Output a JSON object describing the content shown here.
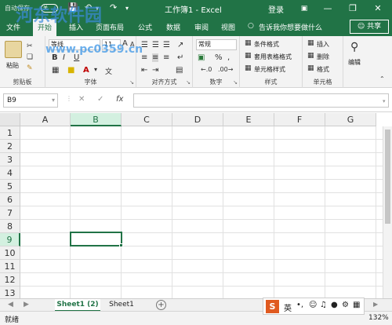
{
  "window": {
    "autosave_label": "自动保存",
    "autosave_state": "关",
    "title": "工作簿1 - Excel",
    "login": "登录",
    "minimize": "—",
    "restore": "❐",
    "close": "✕"
  },
  "ribbon_tabs": [
    "文件",
    "开始",
    "插入",
    "页面布局",
    "公式",
    "数据",
    "审阅",
    "视图"
  ],
  "tell_me": "告诉我你想要做什么",
  "share": "共享",
  "ribbon": {
    "clipboard": {
      "paste": "粘贴",
      "label": "剪贴板"
    },
    "font": {
      "name": "等线",
      "size": "11",
      "label": "字体",
      "bold": "B",
      "italic": "I",
      "underline": "U",
      "font_color": "A",
      "grow": "A",
      "shrink": "A"
    },
    "alignment": {
      "label": "对齐方式"
    },
    "number": {
      "format": "常规",
      "label": "数字",
      "percent": "%",
      "comma": ","
    },
    "styles": {
      "conditional": "条件格式",
      "table": "套用表格格式",
      "cell": "单元格样式",
      "label": "样式"
    },
    "cells": {
      "insert": "插入",
      "delete": "删除",
      "format": "格式",
      "label": "单元格"
    },
    "editing": {
      "label": "编辑"
    }
  },
  "formula_bar": {
    "name_box": "B9",
    "cancel": "✕",
    "enter": "✓",
    "fx": "fx",
    "value": ""
  },
  "columns": [
    "A",
    "B",
    "C",
    "D",
    "E",
    "F",
    "G"
  ],
  "rows": [
    "1",
    "2",
    "3",
    "4",
    "5",
    "6",
    "7",
    "8",
    "9",
    "10",
    "11",
    "12",
    "13"
  ],
  "selected_cell": "B9",
  "sheets": [
    "Sheet1 (2)",
    "Sheet1"
  ],
  "active_sheet": "Sheet1 (2)",
  "status": {
    "ready": "就绪",
    "zoom": "132%"
  },
  "ime": {
    "logo": "S",
    "lang": "英",
    "punct": "•,",
    "emoji": "☺"
  },
  "watermark": {
    "site": "河东软件园",
    "url": "www.pc0359.cn"
  },
  "colors": {
    "accent": "#217346",
    "selection_header": "#d3f0e0"
  }
}
